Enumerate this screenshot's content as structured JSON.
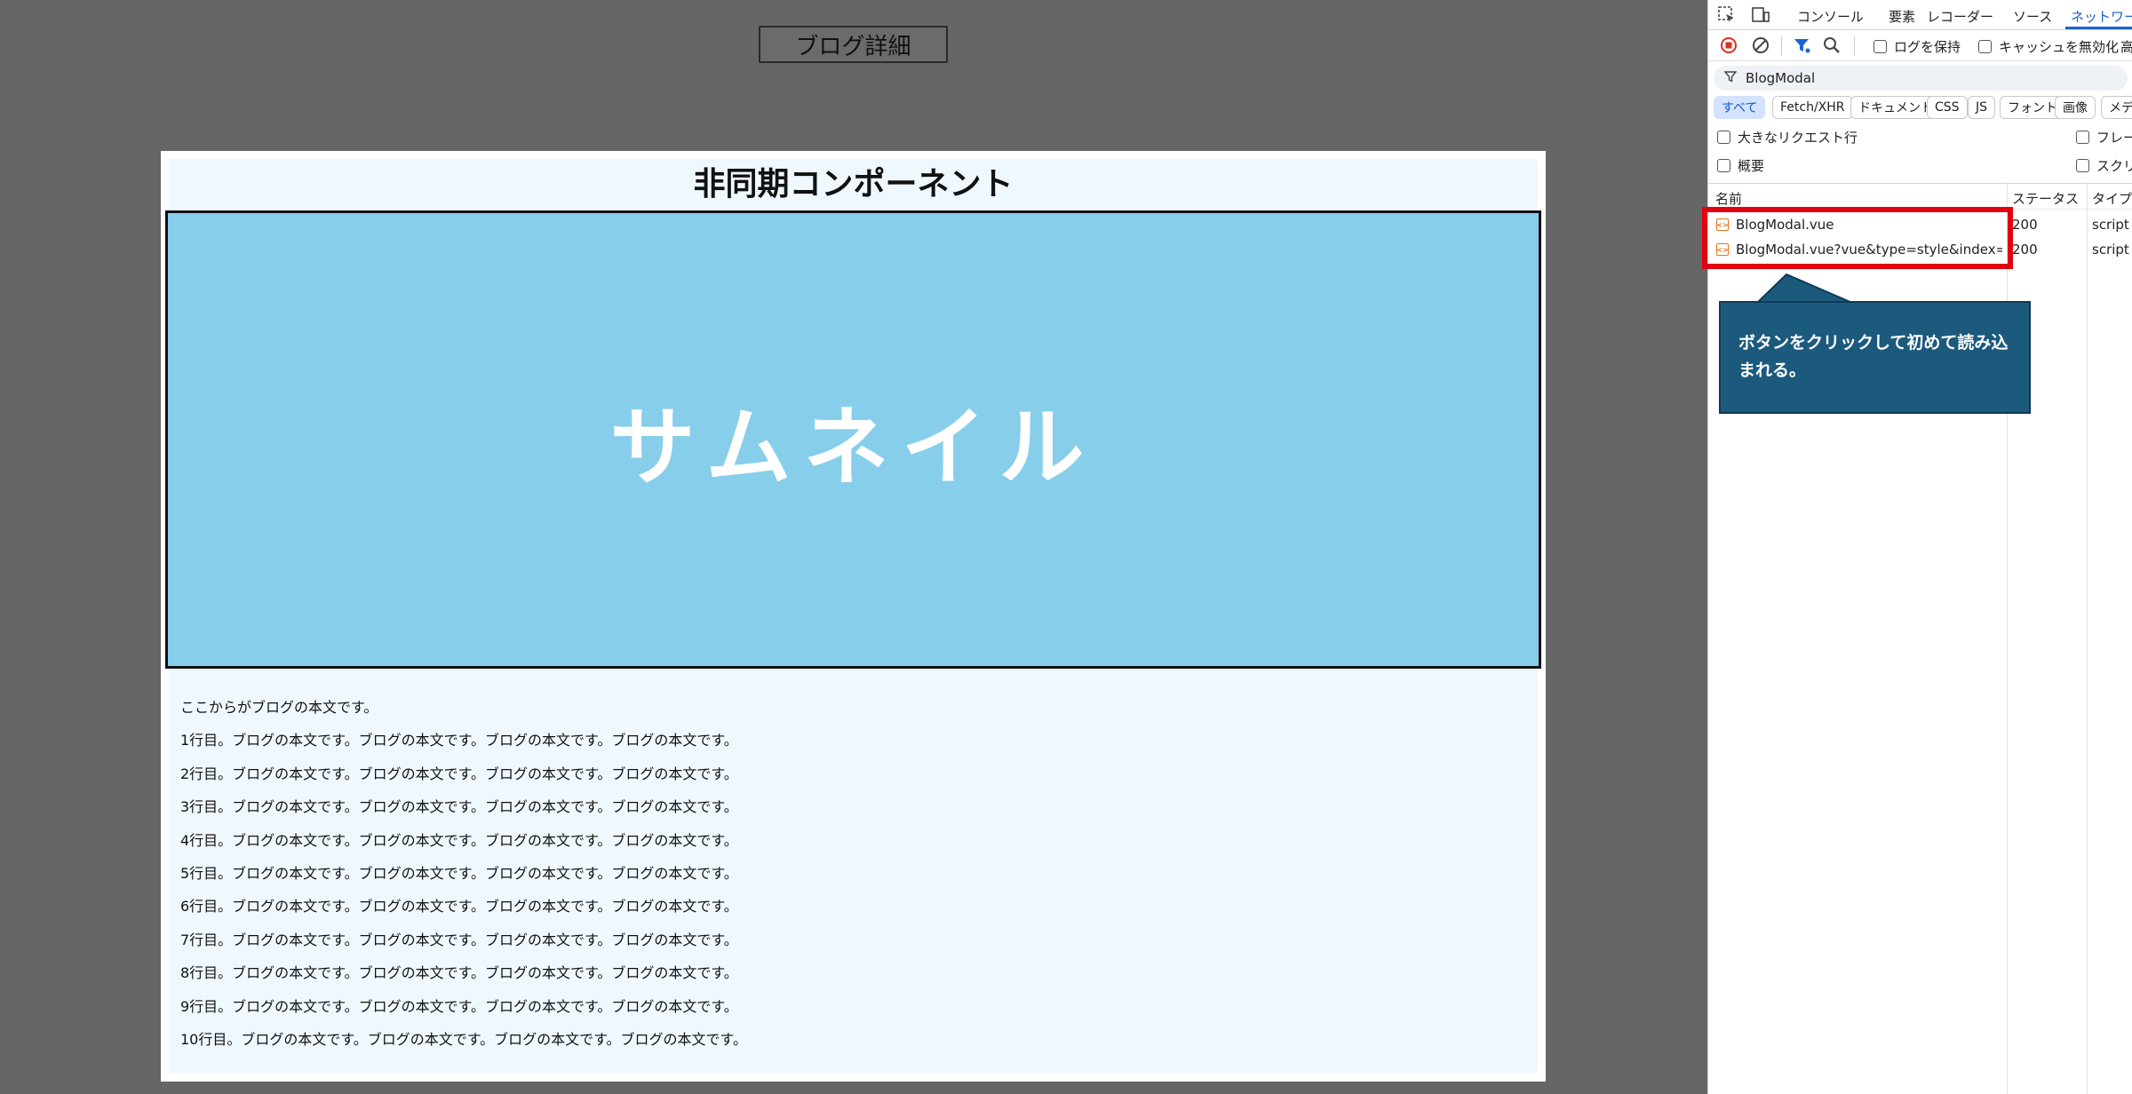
{
  "page": {
    "open_button_label": "ブログ詳細",
    "modal": {
      "title": "非同期コンポーネント",
      "thumbnail_label": "サムネイル",
      "body_lines": [
        "ここからがブログの本文です。",
        "1行目。ブログの本文です。ブログの本文です。ブログの本文です。ブログの本文です。",
        "2行目。ブログの本文です。ブログの本文です。ブログの本文です。ブログの本文です。",
        "3行目。ブログの本文です。ブログの本文です。ブログの本文です。ブログの本文です。",
        "4行目。ブログの本文です。ブログの本文です。ブログの本文です。ブログの本文です。",
        "5行目。ブログの本文です。ブログの本文です。ブログの本文です。ブログの本文です。",
        "6行目。ブログの本文です。ブログの本文です。ブログの本文です。ブログの本文です。",
        "7行目。ブログの本文です。ブログの本文です。ブログの本文です。ブログの本文です。",
        "8行目。ブログの本文です。ブログの本文です。ブログの本文です。ブログの本文です。",
        "9行目。ブログの本文です。ブログの本文です。ブログの本文です。ブログの本文です。",
        "10行目。ブログの本文です。ブログの本文です。ブログの本文です。ブログの本文です。"
      ]
    }
  },
  "devtools": {
    "tabs": [
      "コンソール",
      "要素",
      "レコーダー",
      "ソース",
      "ネットワーク"
    ],
    "active_tab": "ネットワーク",
    "toolbar": {
      "preserve_log": "ログを保持",
      "disable_cache": "キャッシュを無効化",
      "throttle_truncated": "高"
    },
    "filter_value": "BlogModal",
    "type_filters": [
      "すべて",
      "Fetch/XHR",
      "ドキュメント",
      "CSS",
      "JS",
      "フォント",
      "画像",
      "メディ"
    ],
    "options": {
      "large_rows": "大きなリクエスト行",
      "overview": "概要",
      "frames": "フレーム",
      "screenshots": "スクリー"
    },
    "columns": {
      "name": "名前",
      "status": "ステータス",
      "type": "タイプ"
    },
    "requests": [
      {
        "name": "BlogModal.vue",
        "status": "200",
        "type": "script"
      },
      {
        "name": "BlogModal.vue?vue&type=style&index=...",
        "status": "200",
        "type": "script"
      }
    ]
  },
  "annotation": {
    "callout_text": "ボタンをクリックして初めて読み込まれる。",
    "highlight_color": "#e3000f",
    "callout_bg": "#1c5a7d"
  }
}
